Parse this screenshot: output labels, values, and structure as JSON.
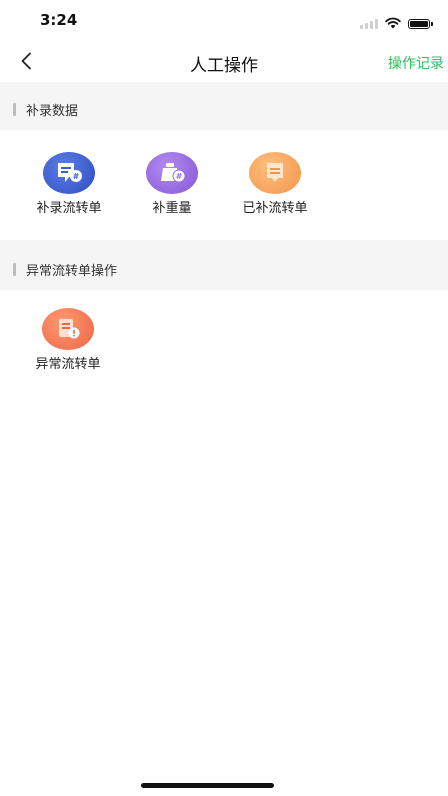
{
  "status_bar": {
    "time": "3:24"
  },
  "nav": {
    "title": "人工操作",
    "action_label": "操作记录",
    "back_icon": "chevron-left-icon"
  },
  "sections": [
    {
      "title": "补录数据",
      "items": [
        {
          "label": "补录流转单",
          "icon": "supplement-transfer-sheet-icon",
          "color": "#3f5fcf"
        },
        {
          "label": "补重量",
          "icon": "supplement-weight-icon",
          "color": "#9d6fe0"
        },
        {
          "label": "已补流转单",
          "icon": "supplemented-transfer-sheet-icon",
          "color": "#f5a35c"
        }
      ]
    },
    {
      "title": "异常流转单操作",
      "items": [
        {
          "label": "异常流转单",
          "icon": "abnormal-transfer-sheet-icon",
          "color": "#f27a55"
        }
      ]
    }
  ],
  "colors": {
    "accent_green": "#2fbf59",
    "section_bg": "#f5f5f5"
  }
}
